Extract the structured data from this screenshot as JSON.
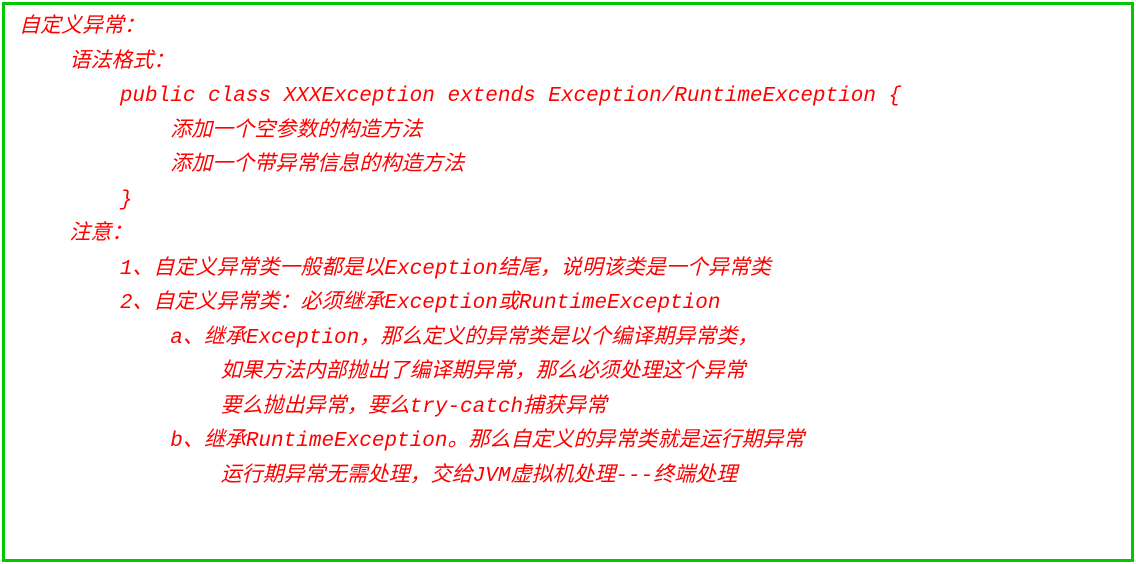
{
  "lines": {
    "l1": "自定义异常：",
    "l2": "    语法格式：",
    "l3": "        public class XXXException extends Exception/RuntimeException {",
    "l4": "            添加一个空参数的构造方法",
    "l5": "            添加一个带异常信息的构造方法",
    "l6": "        }",
    "l7": "    注意：",
    "l8": "        1、自定义异常类一般都是以Exception结尾，说明该类是一个异常类",
    "l9": "        2、自定义异常类：必须继承Exception或RuntimeException",
    "l10": "            a、继承Exception，那么定义的异常类是以个编译期异常类，",
    "l11": "                如果方法内部抛出了编译期异常，那么必须处理这个异常",
    "l12": "                要么抛出异常，要么try-catch捕获异常",
    "l13": "            b、继承RuntimeException。那么自定义的异常类就是运行期异常",
    "l14": "                运行期异常无需处理，交给JVM虚拟机处理---终端处理"
  }
}
